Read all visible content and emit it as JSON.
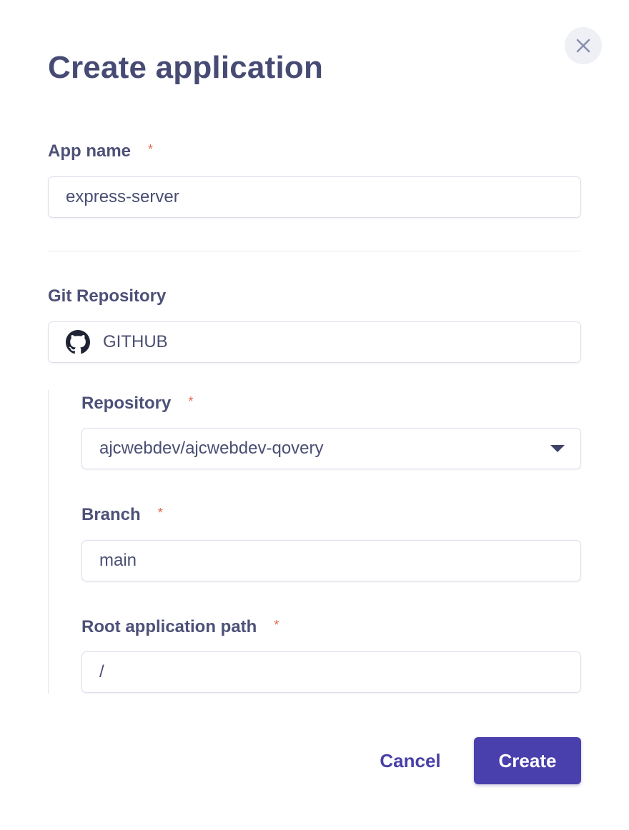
{
  "dialog": {
    "title": "Create application",
    "close_icon": "close-icon"
  },
  "app_name": {
    "label": "App name",
    "required_marker": "*",
    "value": "express-server"
  },
  "git": {
    "label": "Git Repository",
    "provider_icon": "github-icon",
    "provider": "GITHUB"
  },
  "repository": {
    "label": "Repository",
    "required_marker": "*",
    "selected": "ajcwebdev/ajcwebdev-qovery"
  },
  "branch": {
    "label": "Branch",
    "required_marker": "*",
    "value": "main"
  },
  "root_path": {
    "label": "Root application path",
    "required_marker": "*",
    "value": "/"
  },
  "actions": {
    "cancel": "Cancel",
    "create": "Create"
  },
  "colors": {
    "primary": "#4a40ad",
    "required": "#e06a4e",
    "text": "#494d75"
  }
}
